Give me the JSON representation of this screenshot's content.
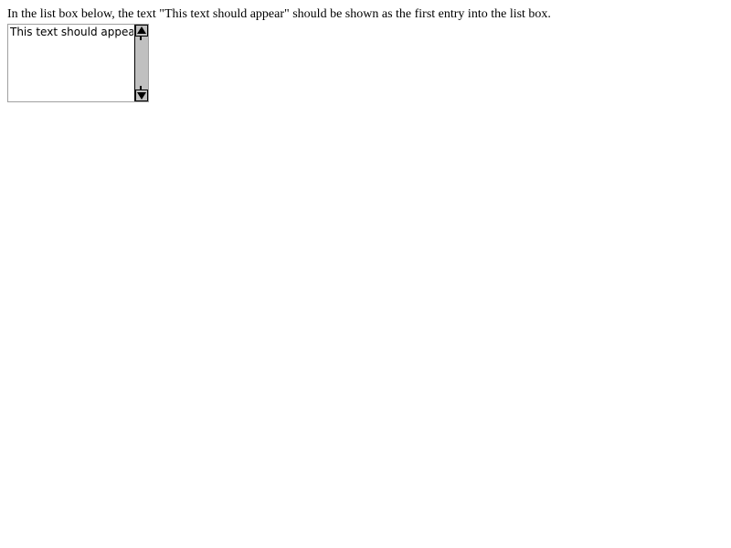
{
  "instruction": "In the list box below, the text \"This text should appear\" should be shown as the first entry into the list box.",
  "listbox": {
    "items": [
      "This text should appear"
    ]
  },
  "scrollbar": {
    "up_icon": "scroll-up-arrow-icon",
    "down_icon": "scroll-down-arrow-icon"
  }
}
